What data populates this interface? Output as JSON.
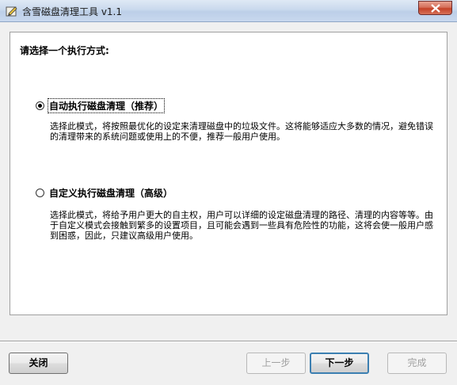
{
  "window": {
    "title": "含雪磁盘清理工具 v1.1"
  },
  "main": {
    "prompt": "请选择一个执行方式:",
    "options": [
      {
        "label": "自动执行磁盘清理（推荐）",
        "selected": true,
        "description": "选择此模式，将按照最优化的设定来清理磁盘中的垃圾文件。这将能够适应大多数的情况，避免错误的清理带来的系统问题或使用上的不便，推荐一般用户使用。"
      },
      {
        "label": "自定义执行磁盘清理（高级）",
        "selected": false,
        "description": "选择此模式，将给予用户更大的自主权，用户可以详细的设定磁盘清理的路径、清理的内容等等。由于自定义模式会接触到繁多的设置项目，且可能会遇到一些具有危险性的功能，这将会使一般用户感到困惑，因此，只建议高级用户使用。"
      }
    ]
  },
  "buttons": {
    "close": "关闭",
    "prev": "上一步",
    "next": "下一步",
    "finish": "完成"
  },
  "colors": {
    "close_button": "#c44127",
    "default_button_border": "#3c7fb1"
  }
}
